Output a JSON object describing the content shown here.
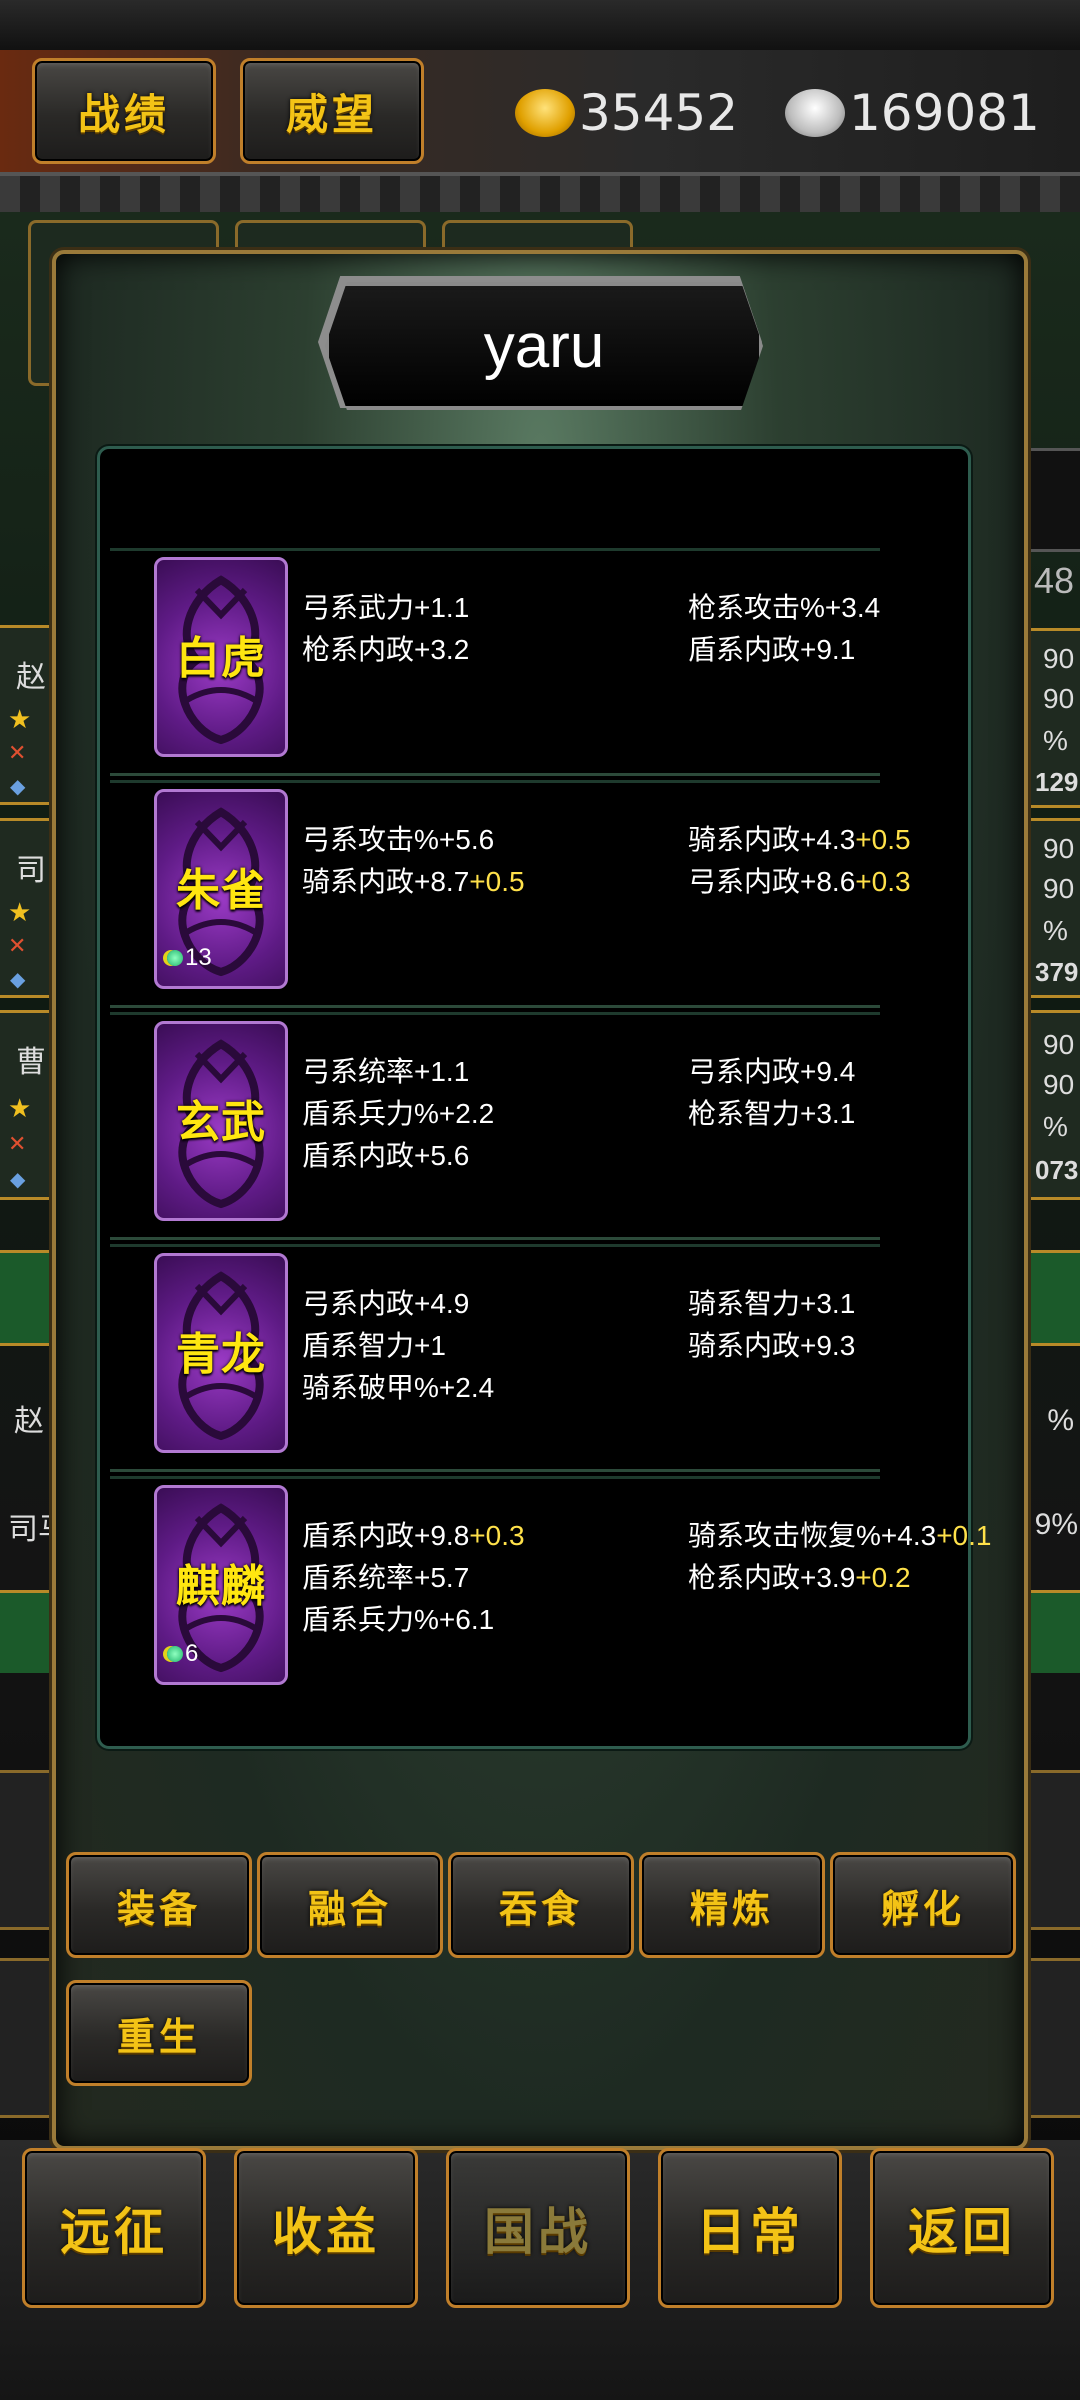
{
  "header": {
    "record_btn": "战绩",
    "prestige_btn": "威望",
    "gold": "35452",
    "silver": "169081",
    "colors": {
      "gold_text": "#f3c316",
      "frame": "#c07f2a"
    }
  },
  "background_fragments": {
    "left": [
      "赵",
      "司",
      "曹",
      "赵",
      "司马"
    ],
    "right": [
      "48",
      "90",
      "90",
      "%",
      "129",
      "90",
      "90",
      "%",
      "379",
      "90",
      "90",
      "%",
      "073",
      "%",
      "9%"
    ]
  },
  "dialog": {
    "title": "yaru",
    "items": [
      {
        "name": "白虎",
        "badge": "",
        "left": [
          {
            "text": "弓系武力+1.1",
            "plus": ""
          },
          {
            "text": "枪系内政+3.2",
            "plus": ""
          }
        ],
        "right": [
          {
            "text": "枪系攻击%+3.4",
            "plus": ""
          },
          {
            "text": "盾系内政+9.1",
            "plus": ""
          }
        ]
      },
      {
        "name": "朱雀",
        "badge": "13",
        "left": [
          {
            "text": "弓系攻击%+5.6",
            "plus": ""
          },
          {
            "text": "骑系内政+8.7",
            "plus": "+0.5"
          }
        ],
        "right": [
          {
            "text": "骑系内政+4.3",
            "plus": "+0.5"
          },
          {
            "text": "弓系内政+8.6",
            "plus": "+0.3"
          }
        ]
      },
      {
        "name": "玄武",
        "badge": "",
        "left": [
          {
            "text": "弓系统率+1.1",
            "plus": ""
          },
          {
            "text": "盾系兵力%+2.2",
            "plus": ""
          },
          {
            "text": "盾系内政+5.6",
            "plus": ""
          }
        ],
        "right": [
          {
            "text": "弓系内政+9.4",
            "plus": ""
          },
          {
            "text": "枪系智力+3.1",
            "plus": ""
          }
        ]
      },
      {
        "name": "青龙",
        "badge": "",
        "left": [
          {
            "text": "弓系内政+4.9",
            "plus": ""
          },
          {
            "text": "盾系智力+1",
            "plus": ""
          },
          {
            "text": "骑系破甲%+2.4",
            "plus": ""
          }
        ],
        "right": [
          {
            "text": "骑系智力+3.1",
            "plus": ""
          },
          {
            "text": "骑系内政+9.3",
            "plus": ""
          }
        ]
      },
      {
        "name": "麒麟",
        "badge": "6",
        "left": [
          {
            "text": "盾系内政+9.8",
            "plus": "+0.3"
          },
          {
            "text": "盾系统率+5.7",
            "plus": ""
          },
          {
            "text": "盾系兵力%+6.1",
            "plus": ""
          }
        ],
        "right": [
          {
            "text": "骑系攻击恢复%+4.3",
            "plus": "+0.1"
          },
          {
            "text": "枪系内政+3.9",
            "plus": "+0.2"
          }
        ]
      }
    ],
    "actions": [
      "装备",
      "融合",
      "吞食",
      "精炼",
      "孵化",
      "重生"
    ]
  },
  "bottom_nav": [
    "远征",
    "收益",
    "国战",
    "日常",
    "返回"
  ]
}
